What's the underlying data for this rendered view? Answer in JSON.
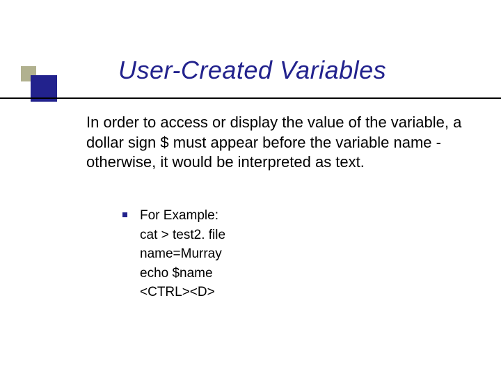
{
  "title": "User-Created Variables",
  "body": "In order to access or display the value of the variable, a dollar sign $ must appear before the variable name - otherwise, it would be interpreted as text.",
  "example": {
    "label": "For Example:",
    "lines": [
      "cat > test2. file",
      "name=Murray",
      "echo $name",
      "<CTRL><D>"
    ]
  }
}
